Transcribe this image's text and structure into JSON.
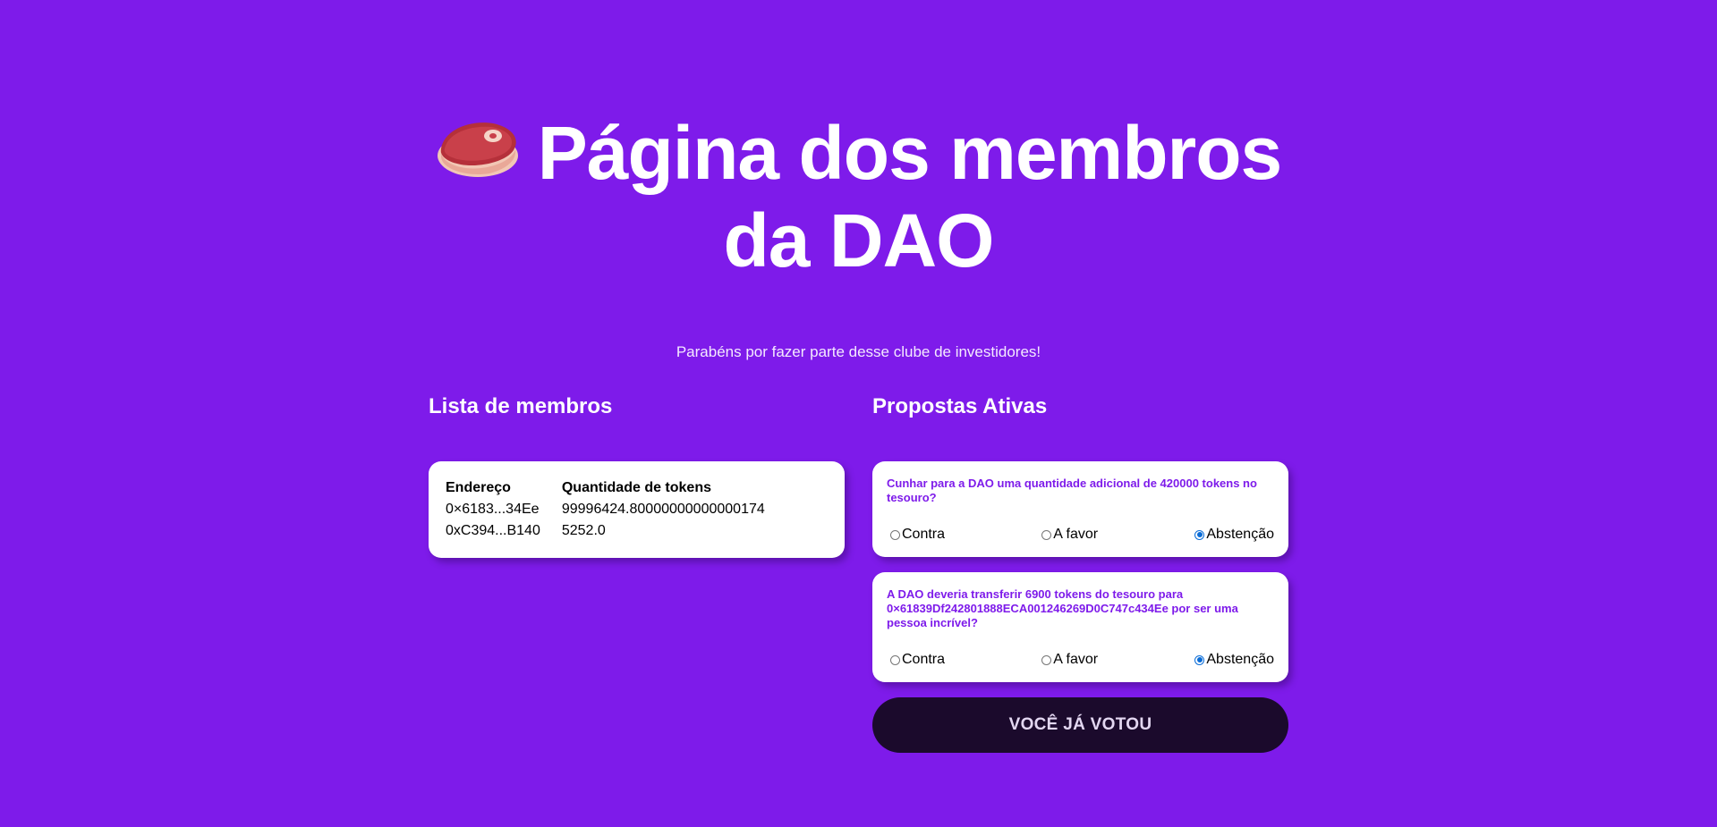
{
  "header": {
    "title": "Página dos membros da DAO",
    "subtitle": "Parabéns por fazer parte desse clube de investidores!",
    "icon": "steak-icon"
  },
  "members": {
    "heading": "Lista de membros",
    "columns": [
      "Endereço",
      "Quantidade de tokens"
    ],
    "rows": [
      {
        "address": "0×6183...34Ee",
        "tokens": "99996424.80000000000000174"
      },
      {
        "address": "0xC394...B140",
        "tokens": "5252.0"
      }
    ]
  },
  "proposals": {
    "heading": "Propostas Ativas",
    "items": [
      {
        "description": "Cunhar para a DAO uma quantidade adicional de 420000 tokens no tesouro?",
        "options": [
          {
            "label": "Contra",
            "checked": false
          },
          {
            "label": "A favor",
            "checked": false
          },
          {
            "label": "Abstenção",
            "checked": true
          }
        ]
      },
      {
        "description": "A DAO deveria transferir 6900 tokens do tesouro para 0×61839Df242801888ECA001246269D0C747c434Ee por ser uma pessoa incrível?",
        "options": [
          {
            "label": "Contra",
            "checked": false
          },
          {
            "label": "A favor",
            "checked": false
          },
          {
            "label": "Abstenção",
            "checked": true
          }
        ]
      }
    ],
    "submit_label": "VOCÊ JÁ VOTOU"
  },
  "colors": {
    "background": "#7e1bea",
    "button": "#1b0a2c",
    "proposal_text": "#7e1bea",
    "radio_checked": "#0a6cd7"
  }
}
